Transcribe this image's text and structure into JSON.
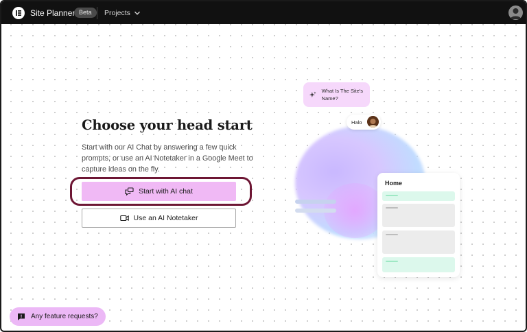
{
  "topbar": {
    "app_title": "Site Planner",
    "badge": "Beta",
    "projects_label": "Projects"
  },
  "main": {
    "heading": "Choose your head start",
    "description": "Start with our AI Chat by answering a few quick prompts, or use an AI Notetaker in a Google Meet to capture ideas on the fly.",
    "primary_button": "Start with AI chat",
    "secondary_button": "Use an AI Notetaker"
  },
  "illustration": {
    "question_bubble": "What Is The Site's Name?",
    "answer_bubble": "Halo",
    "card_title": "Home"
  },
  "footer": {
    "feature_requests": "Any feature requests?"
  },
  "colors": {
    "topbar": "#111111",
    "primary_button": "#f0b9f5",
    "highlight_ring": "#6d1634",
    "feature_button": "#ecb8f6"
  },
  "icons": [
    "elementor-logo-icon",
    "chevron-down-icon",
    "user-avatar-icon",
    "chat-bubbles-icon",
    "video-camera-icon",
    "sparkle-icon",
    "feedback-icon"
  ]
}
